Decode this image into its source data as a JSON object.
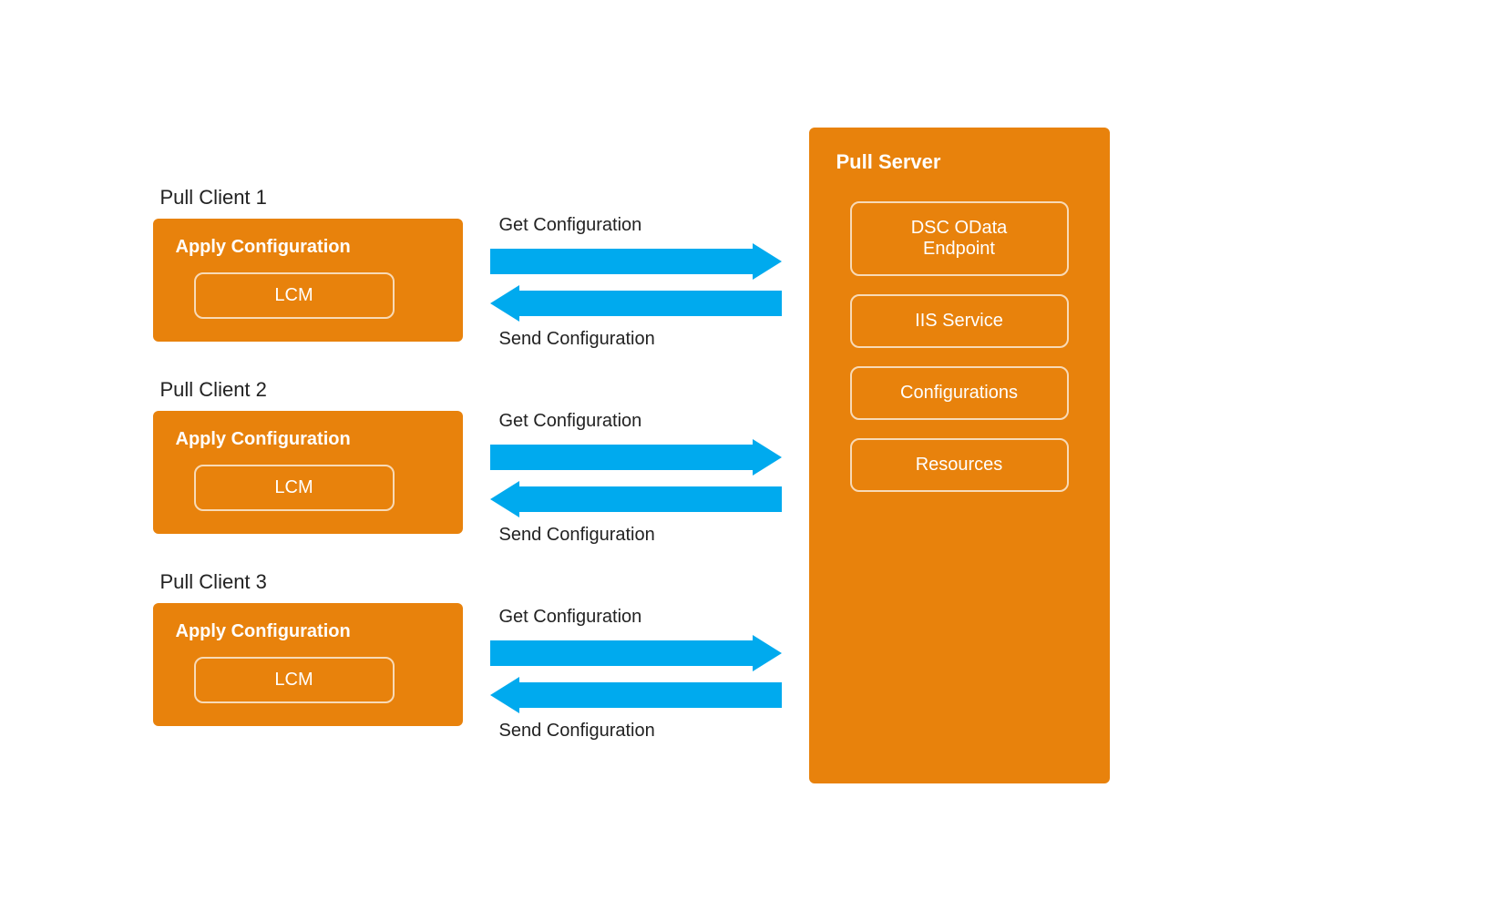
{
  "clients": [
    {
      "label": "Pull Client 1",
      "apply_config": "Apply Configuration",
      "lcm": "LCM"
    },
    {
      "label": "Pull Client 2",
      "apply_config": "Apply Configuration",
      "lcm": "LCM"
    },
    {
      "label": "Pull Client 3",
      "apply_config": "Apply Configuration",
      "lcm": "LCM"
    }
  ],
  "arrows": [
    {
      "top_label": "Get Configuration",
      "bottom_label": "Send Configuration"
    },
    {
      "top_label": "Get Configuration",
      "bottom_label": "Send Configuration"
    },
    {
      "top_label": "Get Configuration",
      "bottom_label": "Send Configuration"
    }
  ],
  "server": {
    "title": "Pull Server",
    "items": [
      {
        "label": "DSC OData\nEndpoint"
      },
      {
        "label": "IIS Service"
      },
      {
        "label": "Configurations"
      },
      {
        "label": "Resources"
      }
    ]
  },
  "colors": {
    "orange": "#E8820C",
    "arrow_blue": "#00AAEE",
    "text_white": "#ffffff",
    "text_dark": "#222222"
  }
}
